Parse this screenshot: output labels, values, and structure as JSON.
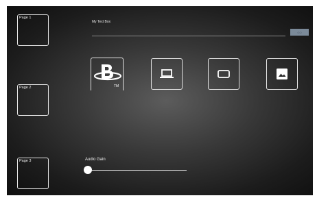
{
  "pages": [
    {
      "label": "Page 1"
    },
    {
      "label": "Page 2"
    },
    {
      "label": "Page 3"
    }
  ],
  "textbox": {
    "label": "My Text Box",
    "value": "",
    "button_label": "GO"
  },
  "sources": [
    {
      "name": "bluray",
      "icon": "bluray-logo-icon"
    },
    {
      "name": "laptop",
      "icon": "laptop-icon"
    },
    {
      "name": "display",
      "icon": "tv-icon"
    },
    {
      "name": "image",
      "icon": "image-icon"
    }
  ],
  "audio_gain": {
    "label": "Audio Gain",
    "level": 0
  }
}
